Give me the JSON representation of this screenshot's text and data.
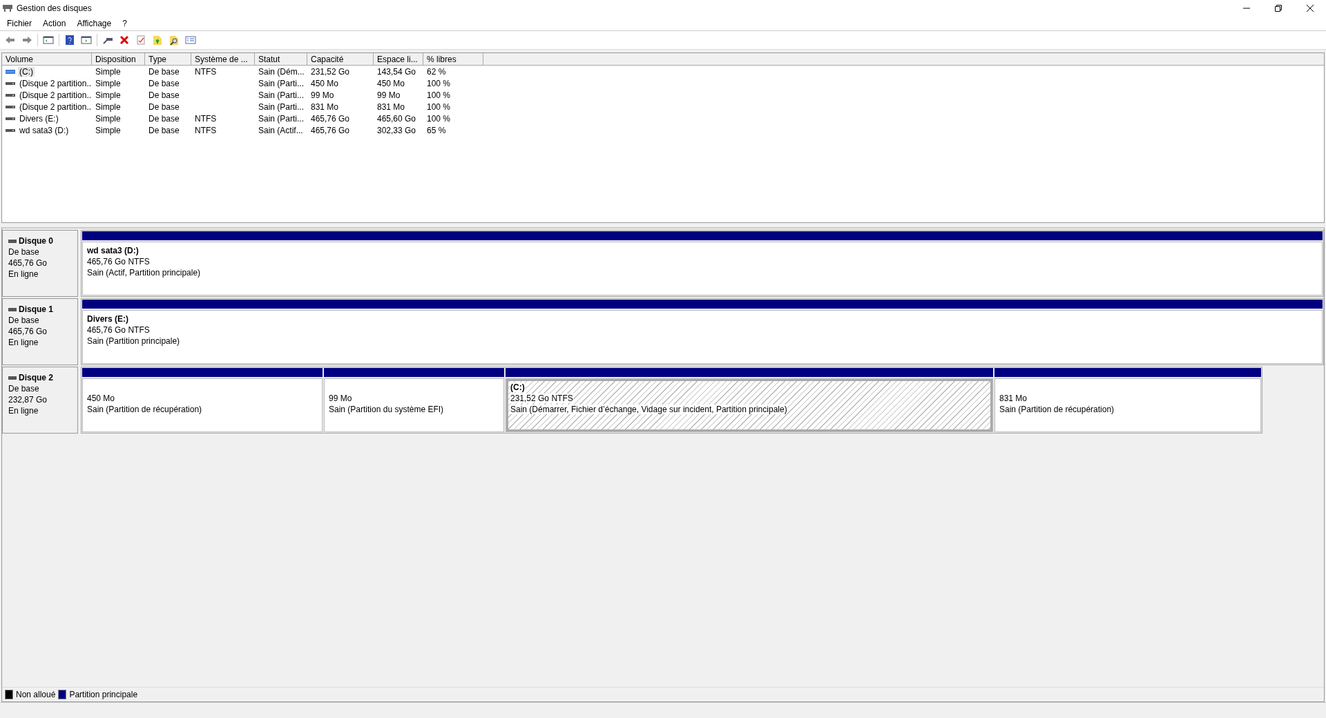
{
  "window": {
    "title": "Gestion des disques"
  },
  "menu": [
    "Fichier",
    "Action",
    "Affichage",
    "?"
  ],
  "table": {
    "columns": [
      "Volume",
      "Disposition",
      "Type",
      "Système de ...",
      "Statut",
      "Capacité",
      "Espace li...",
      "% libres"
    ],
    "rows": [
      {
        "kind": "system",
        "selected": true,
        "cells": [
          "(C:)",
          "Simple",
          "De base",
          "NTFS",
          "Sain (Dém...",
          "231,52 Go",
          "143,54 Go",
          "62 %"
        ]
      },
      {
        "kind": "basic",
        "selected": false,
        "cells": [
          "(Disque 2 partition...",
          "Simple",
          "De base",
          "",
          "Sain (Parti...",
          "450 Mo",
          "450 Mo",
          "100 %"
        ]
      },
      {
        "kind": "basic",
        "selected": false,
        "cells": [
          "(Disque 2 partition...",
          "Simple",
          "De base",
          "",
          "Sain (Parti...",
          "99 Mo",
          "99 Mo",
          "100 %"
        ]
      },
      {
        "kind": "basic",
        "selected": false,
        "cells": [
          "(Disque 2 partition...",
          "Simple",
          "De base",
          "",
          "Sain (Parti...",
          "831 Mo",
          "831 Mo",
          "100 %"
        ]
      },
      {
        "kind": "basic",
        "selected": false,
        "cells": [
          "Divers (E:)",
          "Simple",
          "De base",
          "NTFS",
          "Sain (Parti...",
          "465,76 Go",
          "465,60 Go",
          "100 %"
        ]
      },
      {
        "kind": "basic",
        "selected": false,
        "cells": [
          "wd sata3 (D:)",
          "Simple",
          "De base",
          "NTFS",
          "Sain (Actif...",
          "465,76 Go",
          "302,33 Go",
          "65 %"
        ]
      }
    ]
  },
  "disks": [
    {
      "name": "Disque 0",
      "type": "De base",
      "size": "465,76 Go",
      "state": "En ligne",
      "partitions": [
        {
          "name": "wd sata3  (D:)",
          "size": "465,76 Go NTFS",
          "status": "Sain (Actif, Partition principale)",
          "selected": false
        }
      ]
    },
    {
      "name": "Disque 1",
      "type": "De base",
      "size": "465,76 Go",
      "state": "En ligne",
      "partitions": [
        {
          "name": "Divers  (E:)",
          "size": "465,76 Go NTFS",
          "status": "Sain (Partition principale)",
          "selected": false
        }
      ]
    },
    {
      "name": "Disque 2",
      "type": "De base",
      "size": "232,87 Go",
      "state": "En ligne",
      "partitions": [
        {
          "size": "450 Mo",
          "status": "Sain (Partition de récupération)",
          "selected": false
        },
        {
          "size": "99 Mo",
          "status": "Sain (Partition du système EFI)",
          "selected": false
        },
        {
          "name": "(C:)",
          "size": "231,52 Go NTFS",
          "status": "Sain (Démarrer, Fichier d’échange, Vidage sur incident, Partition principale)",
          "selected": true
        },
        {
          "size": "831 Mo",
          "status": "Sain (Partition de récupération)",
          "selected": false
        }
      ]
    }
  ],
  "legend": [
    {
      "label": "Non alloué",
      "color": "#000000"
    },
    {
      "label": "Partition principale",
      "color": "#000080"
    }
  ]
}
